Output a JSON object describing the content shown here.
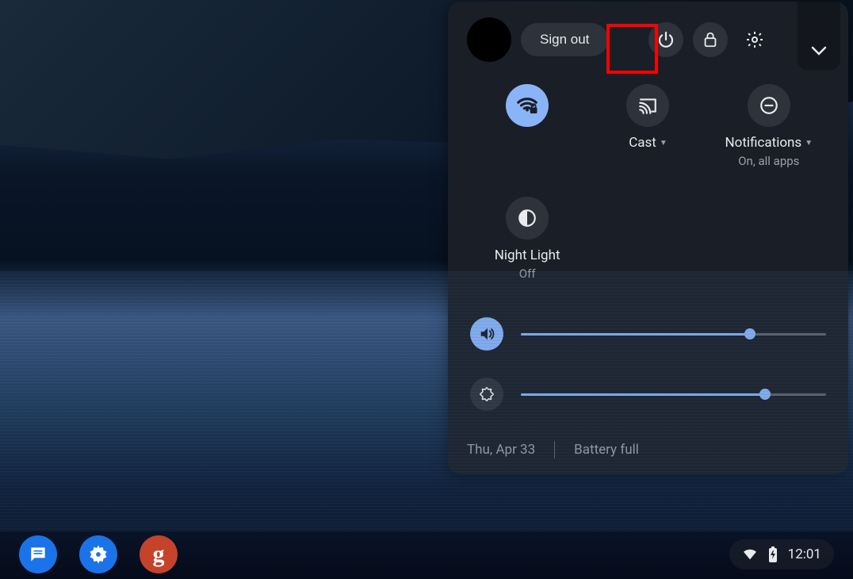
{
  "panel": {
    "sign_out_label": "Sign out",
    "highlight_target": "power-button"
  },
  "toggles": {
    "wifi": {
      "label": "",
      "sublabel": "",
      "active": true
    },
    "cast": {
      "label": "Cast",
      "sublabel": "",
      "active": false,
      "has_dropdown": true
    },
    "notifications": {
      "label": "Notifications",
      "sublabel": "On, all apps",
      "active": false,
      "has_dropdown": true
    },
    "night_light": {
      "label": "Night Light",
      "sublabel": "Off",
      "active": false
    }
  },
  "sliders": {
    "volume": {
      "value": 75
    },
    "brightness": {
      "value": 80
    }
  },
  "footer": {
    "date": "Thu, Apr 33",
    "battery": "Battery full"
  },
  "status": {
    "time": "12:01"
  },
  "shelf": {
    "apps": [
      "messages",
      "settings",
      "gcircle"
    ]
  }
}
